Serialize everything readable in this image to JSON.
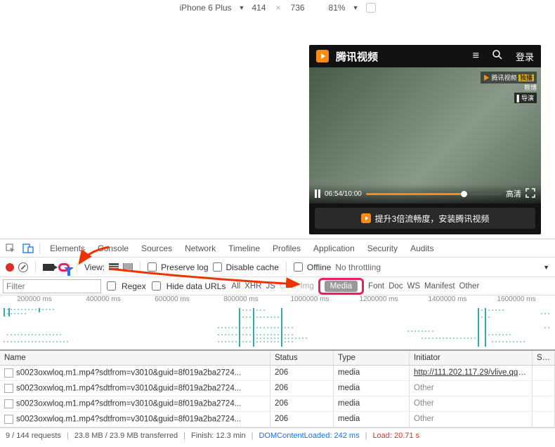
{
  "device_bar": {
    "device": "iPhone 6 Plus",
    "width": "414",
    "height": "736",
    "zoom": "81%"
  },
  "phone": {
    "title": "腾讯视频",
    "login": "登录",
    "badge_brand": "腾讯视频",
    "caption": "熊博",
    "role": "导演",
    "time": "06:54/10:00",
    "quality": "高清",
    "banner": "提升3倍流畅度，安装腾讯视频"
  },
  "tabs": [
    "Elements",
    "Console",
    "Sources",
    "Network",
    "Timeline",
    "Profiles",
    "Application",
    "Security",
    "Audits"
  ],
  "toolbar": {
    "view": "View:",
    "preserve": "Preserve log",
    "disable_cache": "Disable cache",
    "offline": "Offline",
    "throttling": "No throttling"
  },
  "filter": {
    "placeholder": "Filter",
    "regex": "Regex",
    "hide_urls": "Hide data URLs",
    "types": [
      "All",
      "XHR",
      "JS",
      "CSS",
      "Img",
      "Media",
      "Font",
      "Doc",
      "WS",
      "Manifest",
      "Other"
    ]
  },
  "timeline_labels": [
    "200000 ms",
    "400000 ms",
    "600000 ms",
    "800000 ms",
    "1000000 ms",
    "1200000 ms",
    "1400000 ms",
    "1600000 ms"
  ],
  "table": {
    "columns": [
      "Name",
      "Status",
      "Type",
      "Initiator",
      "Size"
    ],
    "rows": [
      {
        "name": "s0023oxwloq.m1.mp4?sdtfrom=v3010&guid=8f019a2ba2724...",
        "status": "206",
        "type": "media",
        "initiator": "http://111.202.117.29/vlive.qqv...",
        "link": true
      },
      {
        "name": "s0023oxwloq.m1.mp4?sdtfrom=v3010&guid=8f019a2ba2724...",
        "status": "206",
        "type": "media",
        "initiator": "Other",
        "link": false
      },
      {
        "name": "s0023oxwloq.m1.mp4?sdtfrom=v3010&guid=8f019a2ba2724...",
        "status": "206",
        "type": "media",
        "initiator": "Other",
        "link": false
      },
      {
        "name": "s0023oxwloq.m1.mp4?sdtfrom=v3010&guid=8f019a2ba2724...",
        "status": "206",
        "type": "media",
        "initiator": "Other",
        "link": false
      }
    ]
  },
  "status_bar": {
    "requests": "9 / 144 requests",
    "transferred": "23.8 MB / 23.9 MB transferred",
    "finish": "Finish: 12.3 min",
    "dcl": "DOMContentLoaded: 242 ms",
    "load": "Load: 20.71 s"
  }
}
